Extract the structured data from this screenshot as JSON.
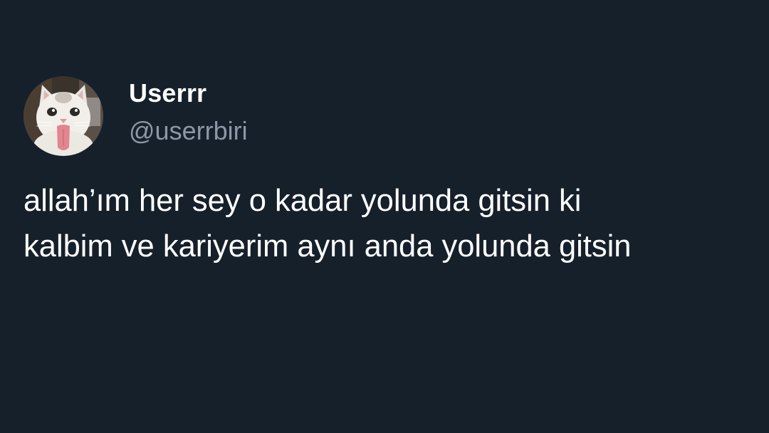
{
  "theme": {
    "background": "#16202b",
    "text_primary": "#ffffff",
    "text_secondary": "#8b98a5"
  },
  "author": {
    "display_name": "Userrr",
    "handle": "@userrbiri",
    "avatar_icon": "cat-avatar"
  },
  "tweet": {
    "lines": [
      "allah’ım her sey o kadar yolunda gitsin ki",
      "kalbim ve kariyerim aynı anda yolunda gitsin"
    ]
  }
}
